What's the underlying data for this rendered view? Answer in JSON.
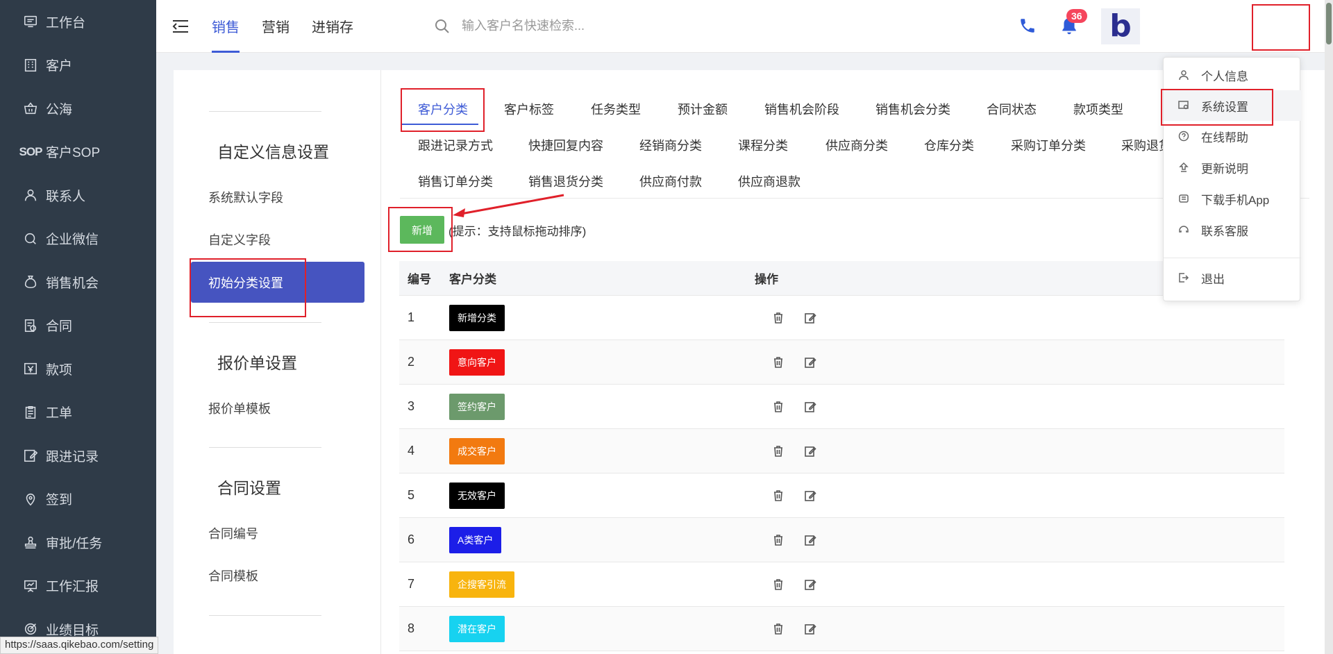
{
  "sidebar": {
    "items": [
      {
        "label": "工作台",
        "icon": "monitor-icon"
      },
      {
        "label": "客户",
        "icon": "building-icon"
      },
      {
        "label": "公海",
        "icon": "basket-icon"
      },
      {
        "label": "客户SOP",
        "icon": "sop-icon",
        "icon_text": "SOP"
      },
      {
        "label": "联系人",
        "icon": "person-icon"
      },
      {
        "label": "企业微信",
        "icon": "chat-icon"
      },
      {
        "label": "销售机会",
        "icon": "moneybag-icon"
      },
      {
        "label": "合同",
        "icon": "contract-icon"
      },
      {
        "label": "款项",
        "icon": "yen-icon"
      },
      {
        "label": "工单",
        "icon": "clipboard-icon"
      },
      {
        "label": "跟进记录",
        "icon": "edit-icon"
      },
      {
        "label": "签到",
        "icon": "location-icon"
      },
      {
        "label": "审批/任务",
        "icon": "stamp-icon"
      },
      {
        "label": "工作汇报",
        "icon": "presentation-icon"
      },
      {
        "label": "业绩目标",
        "icon": "target-icon"
      }
    ]
  },
  "topbar": {
    "tabs": [
      "销售",
      "营销",
      "进销存"
    ],
    "active_tab": "销售",
    "search_placeholder": "输入客户名快速检索...",
    "notification_count": "36",
    "avatar_letter": "b"
  },
  "left_menu": {
    "sections": [
      {
        "title": "自定义信息设置",
        "items": [
          "系统默认字段",
          "自定义字段",
          "初始分类设置"
        ]
      },
      {
        "title": "报价单设置",
        "items": [
          "报价单模板"
        ]
      },
      {
        "title": "合同设置",
        "items": [
          "合同编号",
          "合同模板"
        ]
      }
    ],
    "active_item": "初始分类设置"
  },
  "category_tabs": {
    "row1": [
      "客户分类",
      "客户标签",
      "任务类型",
      "预计金额",
      "销售机会阶段",
      "销售机会分类",
      "合同状态",
      "款项类型"
    ],
    "row2": [
      "跟进记录方式",
      "快捷回复内容",
      "经销商分类",
      "课程分类",
      "供应商分类",
      "仓库分类",
      "采购订单分类",
      "采购退货"
    ],
    "row3": [
      "销售订单分类",
      "销售退货分类",
      "供应商付款",
      "供应商退款"
    ],
    "active": "客户分类"
  },
  "toolbar": {
    "add_label": "新增",
    "hint": "(提示：支持鼠标拖动排序)"
  },
  "table": {
    "headers": [
      "编号",
      "客户分类",
      "操作"
    ],
    "rows": [
      {
        "no": "1",
        "name": "新增分类",
        "color": "#000000"
      },
      {
        "no": "2",
        "name": "意向客户",
        "color": "#f01515"
      },
      {
        "no": "3",
        "name": "签约客户",
        "color": "#6c9a6c"
      },
      {
        "no": "4",
        "name": "成交客户",
        "color": "#f27a10"
      },
      {
        "no": "5",
        "name": "无效客户",
        "color": "#000000"
      },
      {
        "no": "6",
        "name": "A类客户",
        "color": "#1c1ee8"
      },
      {
        "no": "7",
        "name": "企搜客引流",
        "color": "#f8b40e"
      },
      {
        "no": "8",
        "name": "潜在客户",
        "color": "#17d2f0"
      }
    ]
  },
  "dropdown": {
    "items": [
      {
        "label": "个人信息",
        "icon": "user-icon"
      },
      {
        "label": "系统设置",
        "icon": "settings-icon"
      },
      {
        "label": "在线帮助",
        "icon": "help-icon"
      },
      {
        "label": "更新说明",
        "icon": "upload-icon"
      },
      {
        "label": "下载手机App",
        "icon": "app-icon"
      },
      {
        "label": "联系客服",
        "icon": "service-icon"
      },
      {
        "label": "退出",
        "icon": "logout-icon"
      }
    ]
  },
  "status_url": "https://saas.qikebao.com/setting",
  "colors": {
    "accent": "#3e5bd6",
    "sidebar_bg": "#2f3b48",
    "active_menu": "#4654c0",
    "add_button": "#5cb85c",
    "annotation": "#e0202a"
  }
}
